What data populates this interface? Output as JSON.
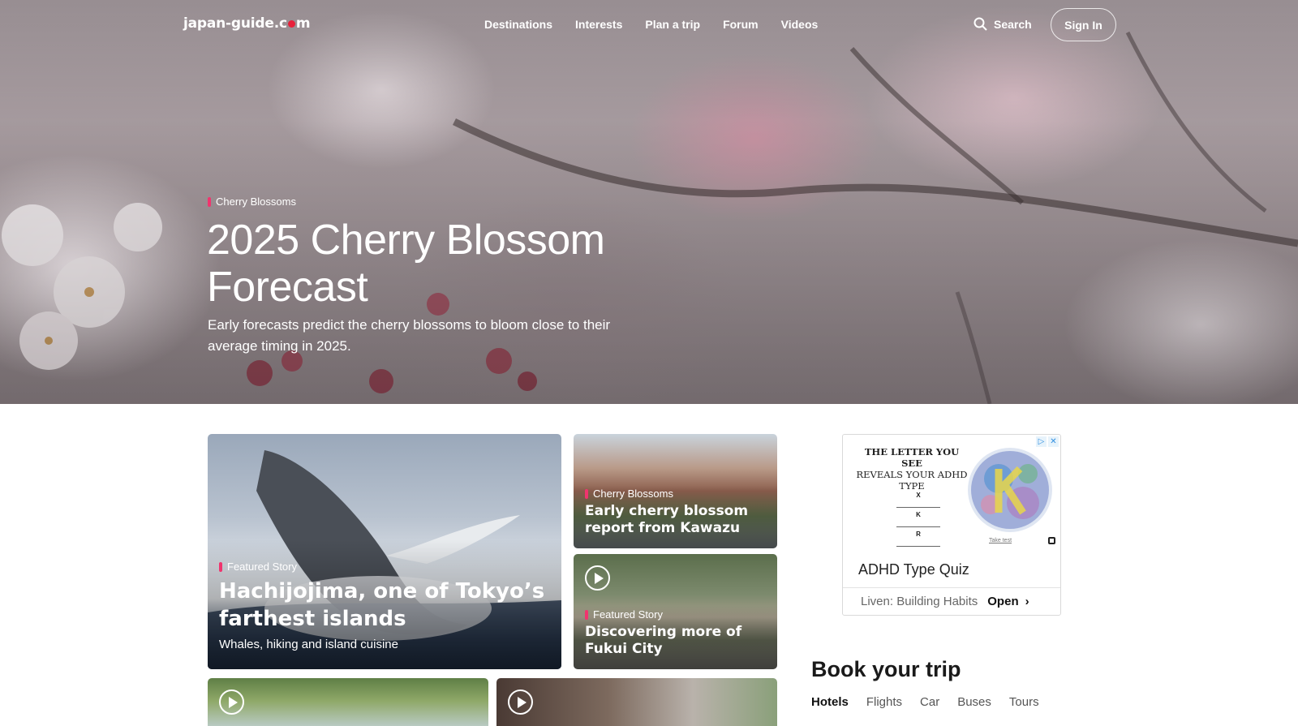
{
  "header": {
    "logo": {
      "part1": "japan-guide.c",
      "part2": "m"
    },
    "nav": [
      "Destinations",
      "Interests",
      "Plan a trip",
      "Forum",
      "Videos"
    ],
    "search_label": "Search",
    "sign_in_label": "Sign In"
  },
  "hero": {
    "category": "Cherry Blossoms",
    "title": "2025 Cherry Blossom Forecast",
    "subtitle": "Early forecasts predict the cherry blossoms to bloom close to their average timing in 2025."
  },
  "cards": {
    "main": {
      "category": "Featured Story",
      "title": "Hachijojima, one of Tokyo’s farthest islands",
      "subtitle": "Whales, hiking and island cuisine"
    },
    "kawazu": {
      "category": "Cherry Blossoms",
      "title": "Early cherry blossom report from Kawazu"
    },
    "fukui": {
      "category": "Featured Story",
      "title": "Discovering more of Fukui City"
    }
  },
  "ad": {
    "headline_line1": "THE LETTER YOU SEE",
    "headline_line2": "REVEALS YOUR ADHD TYPE",
    "letters": [
      "X",
      "K",
      "R"
    ],
    "take_test": "Take test",
    "title": "ADHD Type Quiz",
    "advertiser": "Liven: Building Habits",
    "cta": "Open",
    "accent_color": "#2f8ee0"
  },
  "book": {
    "title": "Book your trip",
    "tabs": [
      "Hotels",
      "Flights",
      "Car",
      "Buses",
      "Tours"
    ]
  },
  "colors": {
    "brand_red": "#e8213b",
    "tag_pink": "#f0346e"
  }
}
